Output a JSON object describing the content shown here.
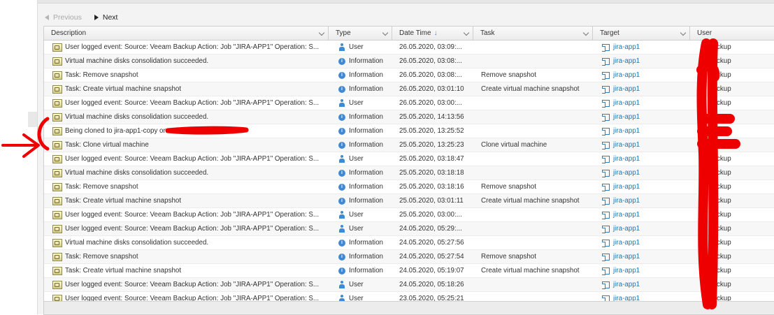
{
  "pager": {
    "previous_label": "Previous",
    "next_label": "Next"
  },
  "columns": {
    "description": "Description",
    "type": "Type",
    "datetime": "Date Time",
    "sort_indicator": "↓",
    "task": "Task",
    "target": "Target",
    "user": "User"
  },
  "rows": [
    {
      "desc": "User logged event: Source: Veeam Backup Action: Job \"JIRA-APP1\" Operation: S...",
      "type": "User",
      "date": "26.05.2020, 03:09:...",
      "task": "",
      "target": "jira-app1",
      "user": "Backup"
    },
    {
      "desc": "Virtual machine disks consolidation succeeded.",
      "type": "Information",
      "date": "26.05.2020, 03:08:...",
      "task": "",
      "target": "jira-app1",
      "user": "Backup"
    },
    {
      "desc": "Task: Remove snapshot",
      "type": "Information",
      "date": "26.05.2020, 03:08:...",
      "task": "Remove snapshot",
      "target": "jira-app1",
      "user": "Backup"
    },
    {
      "desc": "Task: Create virtual machine snapshot",
      "type": "Information",
      "date": "26.05.2020, 03:01:10",
      "task": "Create virtual machine snapshot",
      "target": "jira-app1",
      "user": "Backup"
    },
    {
      "desc": "User logged event: Source: Veeam Backup Action: Job \"JIRA-APP1\" Operation: S...",
      "type": "User",
      "date": "26.05.2020, 03:00:...",
      "task": "",
      "target": "jira-app1",
      "user": "Backup"
    },
    {
      "desc": "Virtual machine disks consolidation succeeded.",
      "type": "Information",
      "date": "25.05.2020, 14:13:56",
      "task": "",
      "target": "jira-app1",
      "user": ""
    },
    {
      "desc": "Being cloned to jira-app1-copy on",
      "type": "Information",
      "date": "25.05.2020, 13:25:52",
      "task": "",
      "target": "jira-app1",
      "user": ""
    },
    {
      "desc": "Task: Clone virtual machine",
      "type": "Information",
      "date": "25.05.2020, 13:25:23",
      "task": "Clone virtual machine",
      "target": "jira-app1",
      "user": ""
    },
    {
      "desc": "User logged event: Source: Veeam Backup Action: Job \"JIRA-APP1\" Operation: S...",
      "type": "User",
      "date": "25.05.2020, 03:18:47",
      "task": "",
      "target": "jira-app1",
      "user": "Backup"
    },
    {
      "desc": "Virtual machine disks consolidation succeeded.",
      "type": "Information",
      "date": "25.05.2020, 03:18:18",
      "task": "",
      "target": "jira-app1",
      "user": "Backup"
    },
    {
      "desc": "Task: Remove snapshot",
      "type": "Information",
      "date": "25.05.2020, 03:18:16",
      "task": "Remove snapshot",
      "target": "jira-app1",
      "user": "Backup"
    },
    {
      "desc": "Task: Create virtual machine snapshot",
      "type": "Information",
      "date": "25.05.2020, 03:01:11",
      "task": "Create virtual machine snapshot",
      "target": "jira-app1",
      "user": "Backup"
    },
    {
      "desc": "User logged event: Source: Veeam Backup Action: Job \"JIRA-APP1\" Operation: S...",
      "type": "User",
      "date": "25.05.2020, 03:00:...",
      "task": "",
      "target": "jira-app1",
      "user": "Backup"
    },
    {
      "desc": "User logged event: Source: Veeam Backup Action: Job \"JIRA-APP1\" Operation: S...",
      "type": "User",
      "date": "24.05.2020, 05:29:...",
      "task": "",
      "target": "jira-app1",
      "user": "Backup"
    },
    {
      "desc": "Virtual machine disks consolidation succeeded.",
      "type": "Information",
      "date": "24.05.2020, 05:27:56",
      "task": "",
      "target": "jira-app1",
      "user": "Backup"
    },
    {
      "desc": "Task: Remove snapshot",
      "type": "Information",
      "date": "24.05.2020, 05:27:54",
      "task": "Remove snapshot",
      "target": "jira-app1",
      "user": "Backup"
    },
    {
      "desc": "Task: Create virtual machine snapshot",
      "type": "Information",
      "date": "24.05.2020, 05:19:07",
      "task": "Create virtual machine snapshot",
      "target": "jira-app1",
      "user": "Backup"
    },
    {
      "desc": "User logged event: Source: Veeam Backup Action: Job \"JIRA-APP1\" Operation: S...",
      "type": "User",
      "date": "24.05.2020, 05:18:26",
      "task": "",
      "target": "jira-app1",
      "user": "Backup"
    },
    {
      "desc": "User logged event: Source: Veeam Backup Action: Job \"JIRA-APP1\" Operation: S...",
      "type": "User",
      "date": "23.05.2020, 05:25:21",
      "task": "",
      "target": "jira-app1",
      "user": "Backup"
    }
  ],
  "colors": {
    "accent": "#3e8ad4",
    "link": "#1b77b8",
    "annotation": "#ee0000"
  }
}
